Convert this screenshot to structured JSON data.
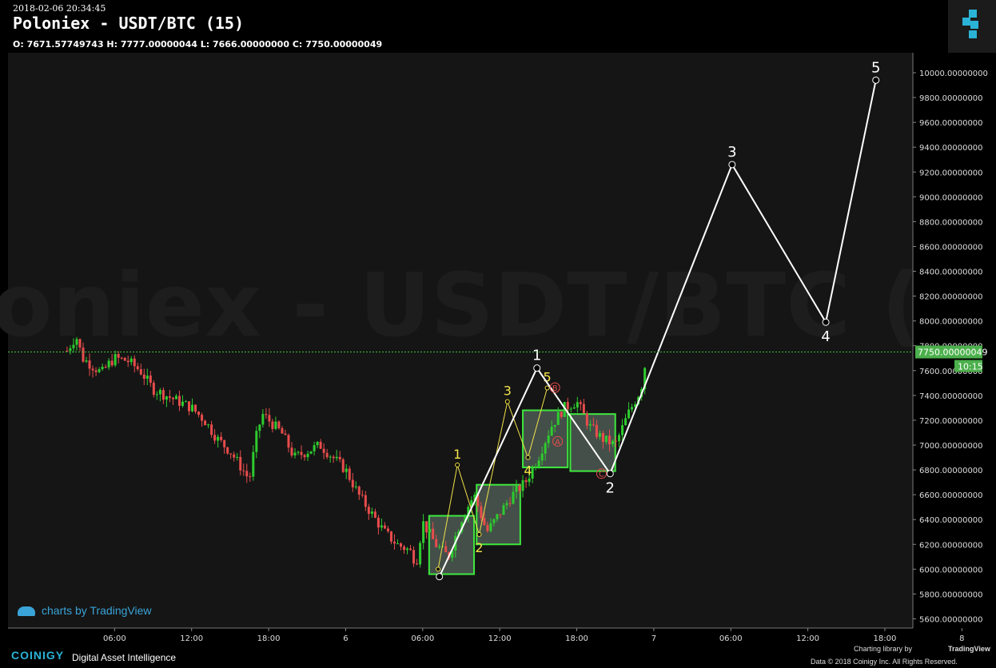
{
  "header": {
    "timestamp": "2018-02-06 20:34:45",
    "title": "Poloniex - USDT/BTC (15)",
    "ohlc": "O: 7671.57749743 H: 7777.00000044 L: 7666.00000000 C: 7750.00000049"
  },
  "watermark": {
    "tradingview": "charts by TradingView"
  },
  "footer": {
    "brand": "COINIGY",
    "tagline": "Digital Asset Intelligence",
    "charting_library": "Charting library by",
    "tradingview": "TradingView",
    "copyright": "Data © 2018  Coinigy Inc. All Rights Reserved."
  },
  "colors": {
    "background": "#000000",
    "plot_background": "#151515",
    "up_candle": "#2ecc2e",
    "down_candle": "#e84c4c",
    "projection_line": "#ffffff",
    "sub_wave_line": "#f2e34a",
    "pattern_box": "#3ee83e",
    "price_badge": "#4cb04c",
    "corrective_marker": "#e84c4c"
  },
  "chart_data": {
    "type": "candlestick",
    "ylim": [
      5560,
      10180
    ],
    "y_ticks": [
      10000,
      9800,
      9600,
      9400,
      9200,
      9000,
      8800,
      8600,
      8400,
      8200,
      8000,
      7800,
      7600,
      7400,
      7200,
      7000,
      6800,
      6600,
      6400,
      6200,
      6000,
      5800,
      5600
    ],
    "y_tick_labels": [
      "10000.00000000",
      "9800.00000000",
      "9600.00000000",
      "9400.00000000",
      "9200.00000000",
      "9000.00000000",
      "8800.00000000",
      "8600.00000000",
      "8400.00000000",
      "8200.00000000",
      "8000.00000000",
      "7800.00000000",
      "7600.00000000",
      "7400.00000000",
      "7200.00000000",
      "7000.00000000",
      "6800.00000000",
      "6600.00000000",
      "6400.00000000",
      "6200.00000000",
      "6000.00000000",
      "5800.00000000",
      "5600.00000000"
    ],
    "x_tick_labels": [
      "06:00",
      "12:00",
      "18:00",
      "6",
      "06:00",
      "12:00",
      "18:00",
      "7",
      "06:00",
      "12:00",
      "18:00",
      "8"
    ],
    "x_tick_hours": [
      6,
      12,
      18,
      24,
      30,
      36,
      42,
      48,
      54,
      60,
      66,
      72
    ],
    "xlim_hours": [
      2.2,
      75
    ],
    "last_price": 7750,
    "last_price_label": "7750.00000049",
    "countdown_label": "10:15",
    "candle_interval_min": 15,
    "candles_hourly_close_path": [
      [
        2.3,
        7760
      ],
      [
        3,
        7880
      ],
      [
        3.5,
        7700
      ],
      [
        4.5,
        7620
      ],
      [
        5,
        7580
      ],
      [
        5.5,
        7650
      ],
      [
        6,
        7700
      ],
      [
        7,
        7680
      ],
      [
        8,
        7600
      ],
      [
        9,
        7450
      ],
      [
        10,
        7400
      ],
      [
        11,
        7350
      ],
      [
        12,
        7300
      ],
      [
        13,
        7200
      ],
      [
        14,
        7050
      ],
      [
        15,
        6950
      ],
      [
        16,
        6800
      ],
      [
        16.5,
        6720
      ],
      [
        17,
        7050
      ],
      [
        17.5,
        7250
      ],
      [
        18,
        7200
      ],
      [
        19,
        7100
      ],
      [
        20,
        6900
      ],
      [
        21,
        6950
      ],
      [
        22,
        7000
      ],
      [
        23,
        6900
      ],
      [
        24,
        6800
      ],
      [
        25,
        6600
      ],
      [
        26,
        6450
      ],
      [
        27,
        6300
      ],
      [
        27.5,
        6250
      ],
      [
        28,
        6200
      ],
      [
        29,
        6150
      ],
      [
        29.5,
        6050
      ],
      [
        30,
        6380
      ],
      [
        31,
        6200
      ],
      [
        32,
        6100
      ],
      [
        33,
        6400
      ],
      [
        34,
        6600
      ],
      [
        35,
        6300
      ],
      [
        36,
        6450
      ],
      [
        37,
        6600
      ],
      [
        38,
        6700
      ],
      [
        39,
        6900
      ],
      [
        40,
        7150
      ],
      [
        41,
        7300
      ],
      [
        42,
        7350
      ],
      [
        43,
        7150
      ],
      [
        44,
        7050
      ],
      [
        45,
        7000
      ],
      [
        46,
        7250
      ],
      [
        47,
        7450
      ],
      [
        47.5,
        7760
      ]
    ],
    "projection_path": [
      {
        "label": "",
        "t": 31.3,
        "y": 5940
      },
      {
        "label": "1",
        "t": 38.9,
        "y": 7620
      },
      {
        "label": "2",
        "t": 44.6,
        "y": 6770
      },
      {
        "label": "3",
        "t": 54.1,
        "y": 9260
      },
      {
        "label": "4",
        "t": 61.4,
        "y": 7990
      },
      {
        "label": "5",
        "t": 65.3,
        "y": 9940
      }
    ],
    "sub_wave_path": [
      {
        "label": "",
        "t": 31.2,
        "y": 6000
      },
      {
        "label": "1",
        "t": 32.7,
        "y": 6840
      },
      {
        "label": "2",
        "t": 34.4,
        "y": 6280
      },
      {
        "label": "3",
        "t": 36.6,
        "y": 7350
      },
      {
        "label": "4",
        "t": 38.2,
        "y": 6900
      },
      {
        "label": "5",
        "t": 39.7,
        "y": 7460
      }
    ],
    "corrective_markers": [
      {
        "label": "B",
        "t": 39.8,
        "y": 7450
      },
      {
        "label": "A",
        "t": 39.7,
        "y": 7030
      },
      {
        "label": "C",
        "t": 44.3,
        "y": 6770
      }
    ],
    "pattern_boxes": [
      {
        "t0": 30.5,
        "t1": 34.0,
        "y0": 5960,
        "y1": 6430
      },
      {
        "t0": 34.2,
        "t1": 37.6,
        "y0": 6200,
        "y1": 6680
      },
      {
        "t0": 37.8,
        "t1": 41.3,
        "y0": 6820,
        "y1": 7280
      },
      {
        "t0": 41.5,
        "t1": 45.0,
        "y0": 6790,
        "y1": 7250
      }
    ]
  }
}
